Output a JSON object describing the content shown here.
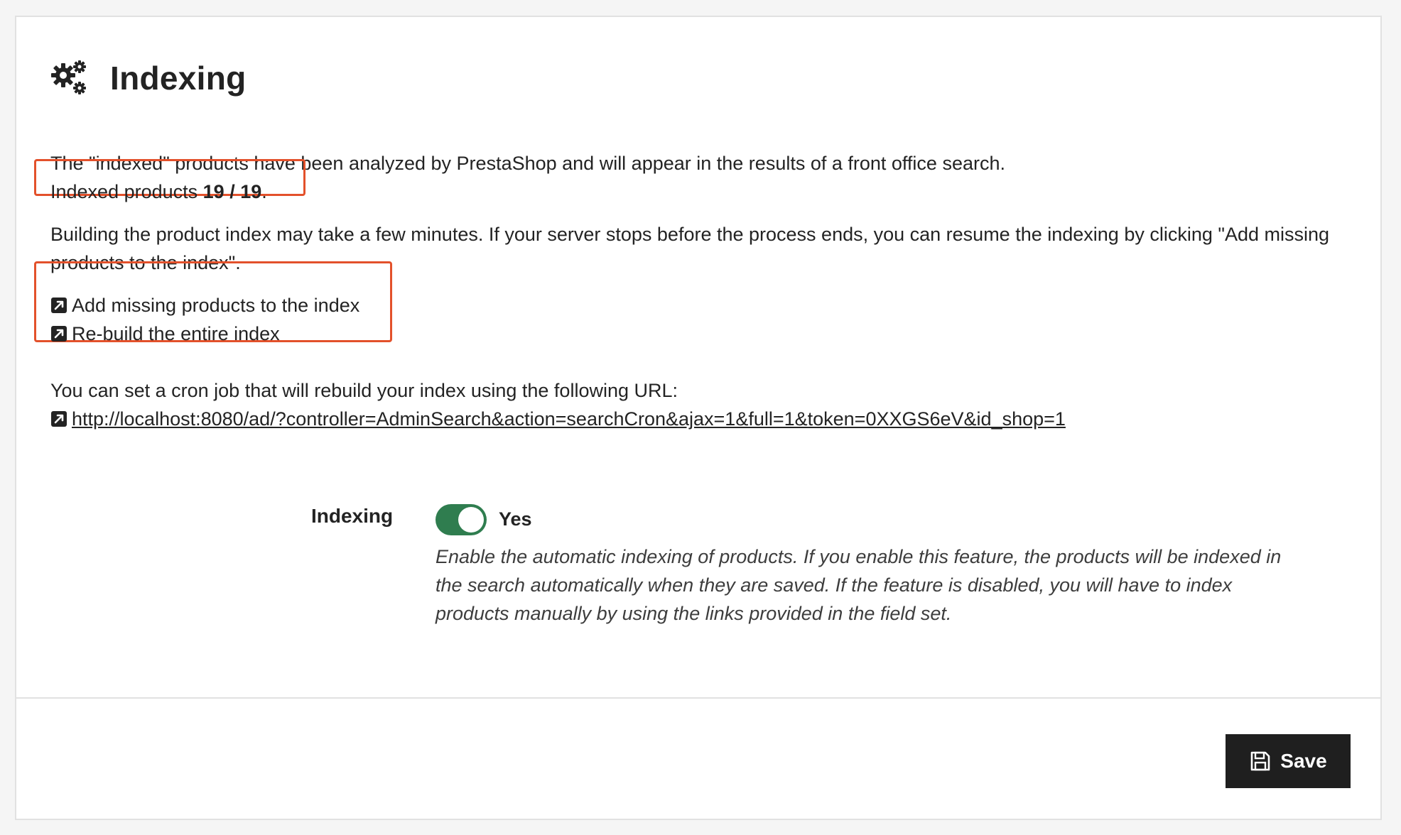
{
  "header": {
    "title": "Indexing",
    "icon": "gears-icon"
  },
  "info": {
    "intro": "The \"indexed\" products have been analyzed by PrestaShop and will appear in the results of a front office search.",
    "indexed_prefix": "Indexed products ",
    "indexed_count": "19 / 19",
    "indexed_suffix": ".",
    "rebuild_note": "Building the product index may take a few minutes. If your server stops before the process ends, you can resume the indexing by clicking \"Add missing products to the index\"."
  },
  "actions": {
    "add_missing": "Add missing products to the index",
    "rebuild": "Re-build the entire index",
    "icon": "external-link-icon"
  },
  "cron": {
    "note": "You can set a cron job that will rebuild your index using the following URL:",
    "url": "http://localhost:8080/ad/?controller=AdminSearch&action=searchCron&ajax=1&full=1&token=0XXGS6eV&id_shop=1"
  },
  "form": {
    "label": "Indexing",
    "switch_value": "Yes",
    "switch_on": true,
    "help": "Enable the automatic indexing of products. If you enable this feature, the products will be indexed in the search automatically when they are saved. If the feature is disabled, you will have to index products manually by using the links provided in the field set."
  },
  "footer": {
    "save_label": "Save",
    "save_icon": "floppy-disk-icon"
  },
  "colors": {
    "highlight": "#e3512b",
    "switch_on": "#2f7d4f",
    "button_bg": "#1f1f1f"
  }
}
